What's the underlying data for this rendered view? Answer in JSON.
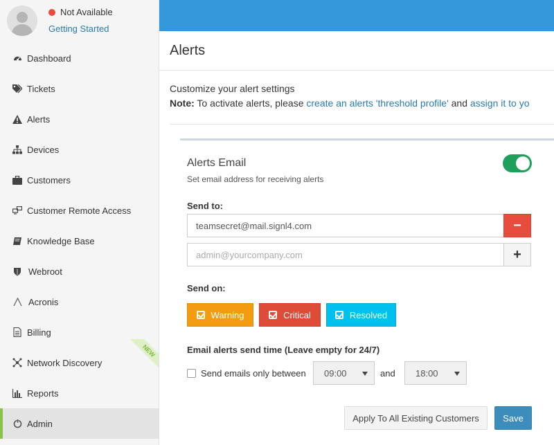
{
  "profile": {
    "status_text": "Not Available",
    "status_color": "#e74c3c",
    "getting_started": "Getting Started"
  },
  "sidebar": {
    "items": [
      {
        "label": "Dashboard",
        "icon": "dashboard-icon"
      },
      {
        "label": "Tickets",
        "icon": "tags-icon"
      },
      {
        "label": "Alerts",
        "icon": "warning-icon"
      },
      {
        "label": "Devices",
        "icon": "sitemap-icon"
      },
      {
        "label": "Customers",
        "icon": "briefcase-icon"
      },
      {
        "label": "Customer Remote Access",
        "icon": "remote-access-icon"
      },
      {
        "label": "Knowledge Base",
        "icon": "book-icon"
      },
      {
        "label": "Webroot",
        "icon": "shield-icon"
      },
      {
        "label": "Acronis",
        "icon": "acronis-icon"
      },
      {
        "label": "Billing",
        "icon": "document-icon"
      },
      {
        "label": "Network Discovery",
        "icon": "network-icon",
        "badge": "NEW"
      },
      {
        "label": "Reports",
        "icon": "bar-chart-icon"
      },
      {
        "label": "Admin",
        "icon": "admin-icon",
        "active": true
      }
    ]
  },
  "page": {
    "title": "Alerts",
    "customize_text": "Customize your alert settings",
    "note_label": "Note:",
    "note_text": " To activate alerts, please ",
    "note_link1": "create an alerts 'threshold profile'",
    "note_and": " and ",
    "note_link2": "assign it to yo"
  },
  "panel": {
    "title": "Alerts Email",
    "description": "Set email address for receiving alerts",
    "toggle_on": true,
    "send_to_label": "Send to:",
    "email_value": "teamsecret@mail.signl4.com",
    "email_placeholder": "admin@yourcompany.com",
    "remove_symbol": "−",
    "add_symbol": "+",
    "send_on_label": "Send on:",
    "levels": [
      {
        "label": "Warning",
        "color": "#f39c12"
      },
      {
        "label": "Critical",
        "color": "#dd4b39"
      },
      {
        "label": "Resolved",
        "color": "#00c0ef"
      }
    ],
    "send_time_label": "Email alerts send time (Leave empty for 24/7)",
    "only_between_label": "Send emails only between",
    "from_time": "09:00",
    "and_label": "and",
    "to_time": "18:00",
    "apply_button": "Apply To All Existing Customers",
    "save_button": "Save"
  },
  "colors": {
    "topbar": "#3498db",
    "link": "#2a7ab0",
    "toggle": "#1ea05a",
    "save": "#3c8dbc",
    "active_accent": "#8bc34a"
  }
}
